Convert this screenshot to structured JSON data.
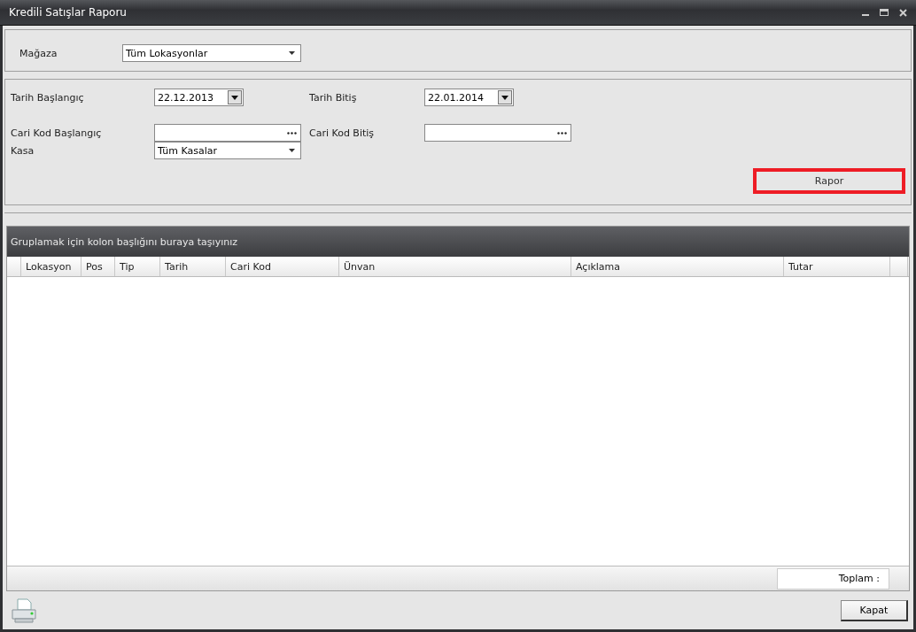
{
  "window": {
    "title": "Kredili Satışlar Raporu"
  },
  "store": {
    "label": "Mağaza",
    "value": "Tüm Lokasyonlar"
  },
  "filters": [
    {
      "label": "Tarih Başlangıç",
      "kind": "date",
      "value": "22.12.2013"
    },
    {
      "label": "Tarih Bitiş",
      "kind": "date",
      "value": "22.01.2014"
    },
    {
      "label": "Cari Kod Başlangıç",
      "kind": "lookup"
    },
    {
      "label": "Cari Kod Bitiş",
      "kind": "lookup"
    },
    {
      "label": "Kasa",
      "kind": "combo",
      "value": "Tüm Kasalar"
    }
  ],
  "report_button": {
    "label": "Rapor",
    "highlighted": true
  },
  "grid": {
    "group_hint": "Gruplamak için kolon başlığını buraya taşıyınız",
    "columns": [
      "Lokasyon",
      "Pos",
      "Tip",
      "Tarih",
      "Cari Kod",
      "Ünvan",
      "Açıklama",
      "Tutar"
    ],
    "footer_total": "Toplam :"
  },
  "close_button": "Kapat"
}
